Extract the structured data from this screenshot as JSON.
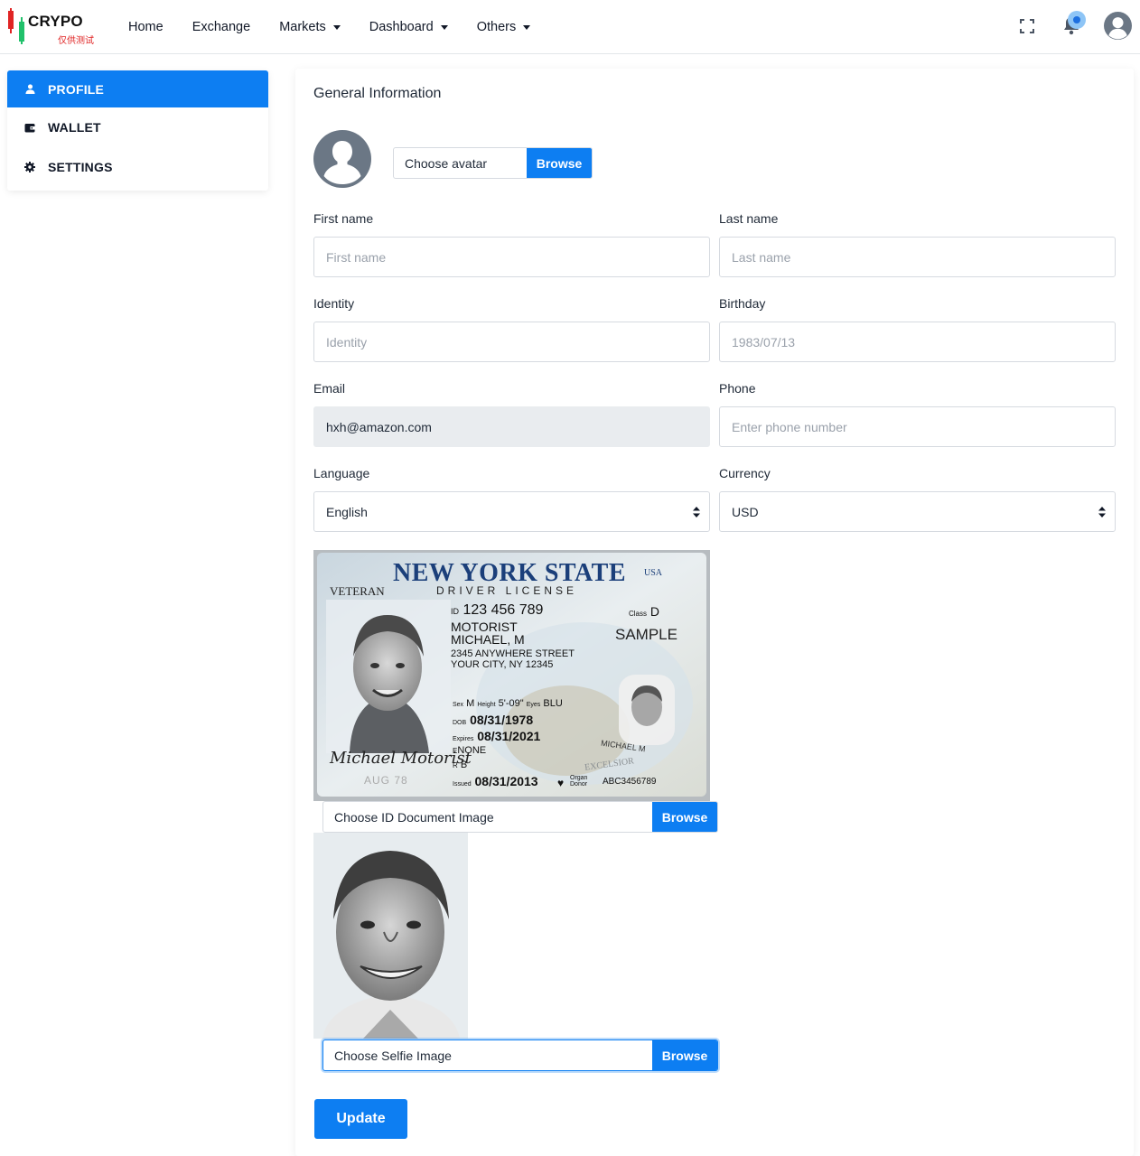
{
  "brand": {
    "name": "CRYPO",
    "sub": "仅供测试"
  },
  "nav": [
    {
      "label": "Home",
      "dropdown": false
    },
    {
      "label": "Exchange",
      "dropdown": false
    },
    {
      "label": "Markets",
      "dropdown": true
    },
    {
      "label": "Dashboard",
      "dropdown": true
    },
    {
      "label": "Others",
      "dropdown": true
    }
  ],
  "header_icons": [
    "fullscreen-icon",
    "bell-icon",
    "user-avatar-icon"
  ],
  "sidebar": {
    "items": [
      {
        "label": "PROFILE",
        "icon": "user-icon",
        "active": true
      },
      {
        "label": "WALLET",
        "icon": "wallet-icon",
        "active": false
      },
      {
        "label": "SETTINGS",
        "icon": "gear-icon",
        "active": false
      }
    ]
  },
  "main": {
    "title": "General Information",
    "avatar_upload": {
      "label": "Choose avatar",
      "button": "Browse"
    },
    "fields": {
      "first_name": {
        "label": "First name",
        "value": "",
        "placeholder": "First name"
      },
      "last_name": {
        "label": "Last name",
        "value": "",
        "placeholder": "Last name"
      },
      "identity": {
        "label": "Identity",
        "value": "",
        "placeholder": "Identity"
      },
      "birthday": {
        "label": "Birthday",
        "value": "",
        "placeholder": "1983/07/13"
      },
      "email": {
        "label": "Email",
        "value": "hxh@amazon.com",
        "disabled": true
      },
      "phone": {
        "label": "Phone",
        "value": "",
        "placeholder": "Enter phone number"
      },
      "language": {
        "label": "Language",
        "value": "English"
      },
      "currency": {
        "label": "Currency",
        "value": "USD"
      }
    },
    "id_card": {
      "state_title": "NEW YORK STATE",
      "country": "USA",
      "subtitle": "DRIVER LICENSE",
      "veteran": "VETERAN",
      "id_prefix": "ID",
      "id_number": "123 456 789",
      "last_name": "MOTORIST",
      "first_name": "MICHAEL, M",
      "address1": "2345 ANYWHERE STREET",
      "address2": "YOUR CITY, NY  12345",
      "class_label": "Class",
      "class_value": "D",
      "sample": "SAMPLE",
      "sex_label": "Sex",
      "sex": "M",
      "height_label": "Height",
      "height": "5'-09\"",
      "eyes_label": "Eyes",
      "eyes": "BLU",
      "dob_label": "DOB",
      "dob": "08/31/1978",
      "expires_label": "Expires",
      "expires": "08/31/2021",
      "e_label": "E",
      "endorsements": "NONE",
      "r_label": "R",
      "restrictions": "B",
      "issued_label": "Issued",
      "issued": "08/31/2013",
      "organ_donor": "Organ Donor",
      "doc_number": "ABC3456789",
      "signature": "Michael Motorist",
      "aug": "AUG 78",
      "excelsior": "EXCELSIOR",
      "ghost_name": "MICHAEL M"
    },
    "id_upload": {
      "label": "Choose ID Document Image",
      "button": "Browse"
    },
    "selfie_upload": {
      "label": "Choose Selfie Image",
      "button": "Browse"
    },
    "update_button": "Update"
  },
  "colors": {
    "primary": "#0d7ef2",
    "disabled_bg": "#e9ecef",
    "logo_red": "#e02424",
    "logo_green": "#21c16b"
  }
}
